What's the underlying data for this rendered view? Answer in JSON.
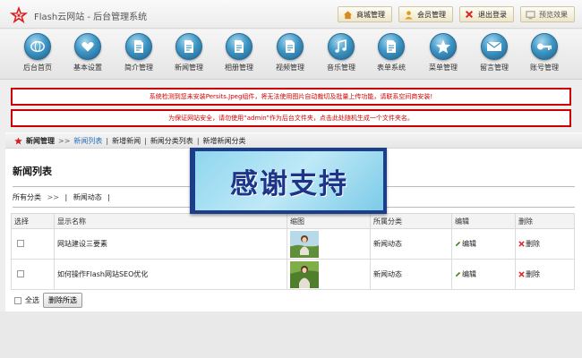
{
  "brand": {
    "title": "Flash云网站 - 后台管理系统"
  },
  "topbar": {
    "buttons": [
      {
        "label": "商城管理",
        "icon": "home-icon"
      },
      {
        "label": "会员管理",
        "icon": "user-icon"
      },
      {
        "label": "退出登录",
        "icon": "close-icon"
      },
      {
        "label": "预览效果",
        "icon": "preview-icon"
      }
    ]
  },
  "nav": {
    "items": [
      {
        "label": "后台首页",
        "icon": "home-globe-icon"
      },
      {
        "label": "基本设置",
        "icon": "heart-icon"
      },
      {
        "label": "简介管理",
        "icon": "document-icon"
      },
      {
        "label": "新闻管理",
        "icon": "document-icon"
      },
      {
        "label": "相册管理",
        "icon": "document-icon"
      },
      {
        "label": "视频管理",
        "icon": "document-icon"
      },
      {
        "label": "音乐管理",
        "icon": "music-icon"
      },
      {
        "label": "表单系统",
        "icon": "document-icon"
      },
      {
        "label": "菜单管理",
        "icon": "star-icon"
      },
      {
        "label": "留言管理",
        "icon": "mail-icon"
      },
      {
        "label": "账号管理",
        "icon": "key-icon"
      }
    ]
  },
  "alerts": [
    "系统检测到您未安装Persits.Jpeg组件，将无法使用图片自动裁切及批量上传功能，请联系空间商安装!",
    "为保证网站安全，请勿使用“admin”作为后台文件夹，点击此处随机生成一个文件夹名。"
  ],
  "breadcrumb": {
    "root": "新闻管理",
    "sep": ">>",
    "current": "新闻列表",
    "links": [
      "新增新闻",
      "新闻分类列表",
      "新增新闻分类"
    ]
  },
  "page": {
    "title": "新闻列表",
    "filter_all": "所有分类",
    "filter_sep": ">>",
    "filter_item": "新闻动态"
  },
  "table": {
    "headers": [
      "选择",
      "显示名称",
      "缩图",
      "所属分类",
      "编辑",
      "删除"
    ],
    "rows": [
      {
        "name": "网站建设三要素",
        "category": "新闻动态",
        "edit": "编辑",
        "delete": "删除"
      },
      {
        "name": "如何操作Flash网站SEO优化",
        "category": "新闻动态",
        "edit": "编辑",
        "delete": "删除"
      }
    ]
  },
  "footer": {
    "select_all": "全选",
    "delete_selected": "删除所选"
  },
  "banner": {
    "text": "感谢支持"
  },
  "colors": {
    "accent": "#2a6fb8",
    "alert": "#cc0000",
    "banner_text": "#1e3488"
  }
}
